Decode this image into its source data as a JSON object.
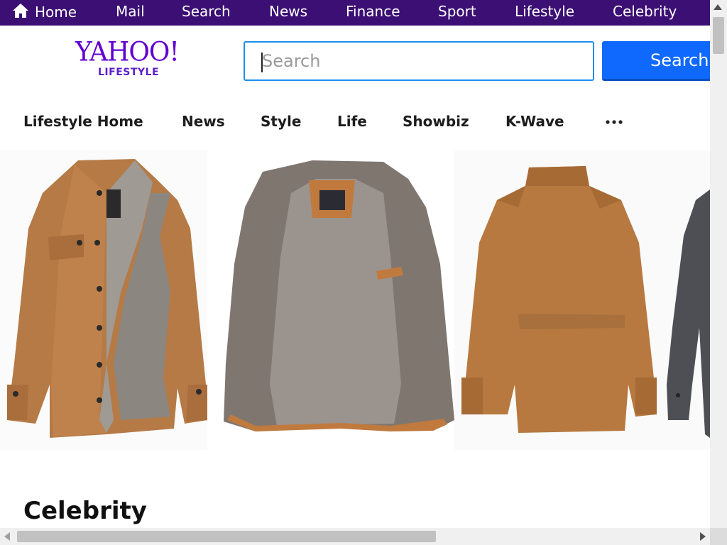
{
  "top_nav": {
    "items": [
      {
        "label": "Home",
        "icon": "home-icon"
      },
      {
        "label": "Mail"
      },
      {
        "label": "Search"
      },
      {
        "label": "News"
      },
      {
        "label": "Finance"
      },
      {
        "label": "Sport"
      },
      {
        "label": "Lifestyle"
      },
      {
        "label": "Celebrity"
      }
    ],
    "background": "#3b0f73"
  },
  "header": {
    "logo_main": "YAHOO!",
    "logo_sub": "LIFESTYLE",
    "search_placeholder": "Search",
    "search_value": "",
    "search_button": "Search",
    "accent": "#0f69ff"
  },
  "section_nav": {
    "items": [
      "Lifestyle Home",
      "News",
      "Style",
      "Life",
      "Showbiz",
      "K-Wave"
    ],
    "more_icon": "more-dots-icon"
  },
  "gallery": {
    "images": [
      "tan-leather-jacket-front",
      "fleece-lining-inside",
      "tan-leather-jacket-back",
      "grey-jacket-partial"
    ]
  },
  "content": {
    "headline": "Celebrity"
  }
}
